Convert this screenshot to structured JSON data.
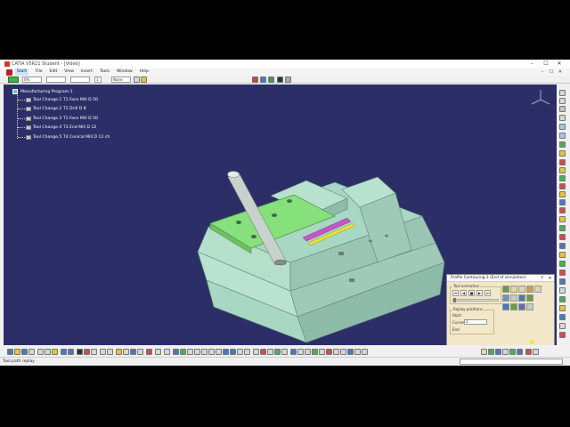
{
  "window": {
    "title": "CATIA V5R21 Student - [Video]",
    "controls": [
      "–",
      "☐",
      "✕"
    ]
  },
  "menu": {
    "items": [
      "Start",
      "File",
      "Edit",
      "View",
      "Insert",
      "Tools",
      "Window",
      "Help"
    ],
    "doc_controls": [
      "–",
      "☐",
      "✕"
    ]
  },
  "properties": {
    "transparency": "0%",
    "line_thickness": "1",
    "layer": "None",
    "color_hex": "#22c52b"
  },
  "spec_tree": {
    "root": "Manufacturing Program.1",
    "items": [
      "Tool Change.1  T1 Face Mill D 50",
      "Tool Change.2  T2 Drill D 8",
      "Tool Change.3  T1 Face Mill D 50",
      "Tool Change.4  T3 End Mill D 12",
      "Tool Change.5  T4 Conical Mill D 12 ch"
    ]
  },
  "simulation_panel": {
    "title": "Profile Contouring.3 (End of simulation)",
    "help_label": "?",
    "close_label": "✕",
    "tool_animation_label": "Tool animation",
    "replay_positions_label": "Replay positions",
    "start_label": "Start",
    "current_label": "Current",
    "current_value": "1",
    "end_label": "End",
    "player_buttons": [
      "⏮",
      "◀",
      "■",
      "▶",
      "⏭"
    ],
    "ok_label": "OK"
  },
  "status": {
    "text": "Tool path replay"
  },
  "colors": {
    "viewport_bg": "#2c2f67",
    "stock": "#a8d7c3",
    "finished_face": "#86e07c",
    "tool": "#c8d1cc",
    "slot_magenta": "#c256c6",
    "slot_yellow": "#e6e23a"
  },
  "icons": {
    "right_toolbar": "machining-operations-icons",
    "bottom_toolbar": "standard-view-icons"
  }
}
